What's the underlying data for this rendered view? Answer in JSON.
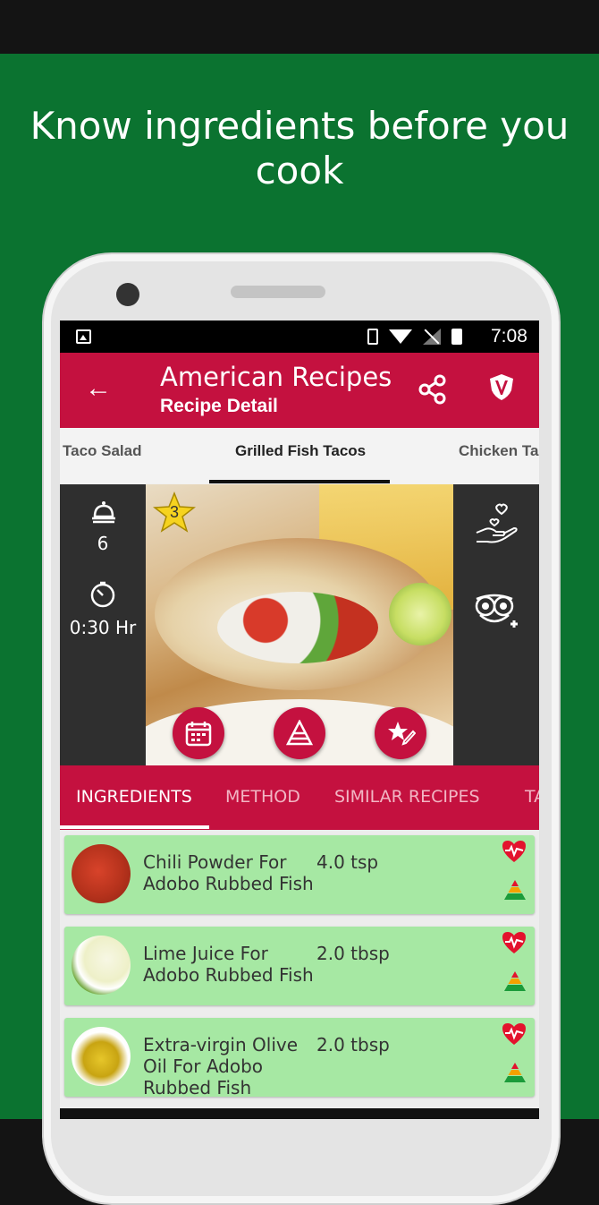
{
  "headline": "Know ingredients before you cook",
  "status_bar": {
    "time": "7:08"
  },
  "app_bar": {
    "title": "American Recipes",
    "subtitle": "Recipe Detail",
    "back_icon": "arrow-left-icon",
    "share_icon": "share-icon",
    "logo_icon": "rv-shield-icon",
    "color": "#c4113f"
  },
  "recipe_tabs": [
    "Taco Salad",
    "Grilled Fish Tacos",
    "Chicken Ta"
  ],
  "hero": {
    "servings": "6",
    "time": "0:30 Hr",
    "rating_badge": "3"
  },
  "detail_tabs": [
    "INGREDIENTS",
    "METHOD",
    "SIMILAR RECIPES",
    "TA"
  ],
  "ingredients": [
    {
      "name": "Chili Powder For Adobo Rubbed Fish",
      "qty": "4.0 tsp"
    },
    {
      "name": "Lime Juice For Adobo Rubbed Fish",
      "qty": "2.0 tbsp"
    },
    {
      "name": "Extra-virgin Olive Oil For Adobo Rubbed Fish",
      "qty": "2.0 tbsp"
    }
  ],
  "colors": {
    "brand_green": "#0b7330",
    "card_green": "#a6e8a3"
  }
}
